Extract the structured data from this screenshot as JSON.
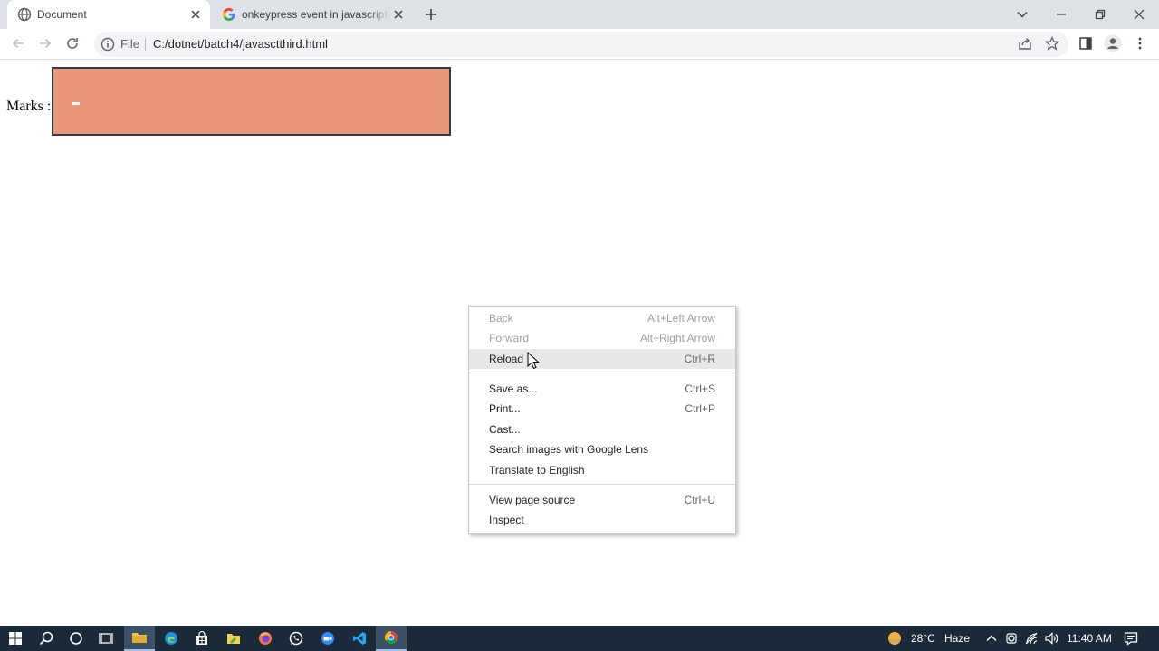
{
  "tabs": [
    {
      "title": "Document",
      "icon": "globe-icon",
      "active": true
    },
    {
      "title": "onkeypress event in javascript - Google Search",
      "icon": "google-icon",
      "active": false
    }
  ],
  "toolbar": {
    "omnibox_scheme": "File",
    "url": "C:/dotnet/batch4/javasctthird.html"
  },
  "page": {
    "marks_label": "Marks :",
    "marks_value": ""
  },
  "context_menu": {
    "items": [
      {
        "label": "Back",
        "shortcut": "Alt+Left Arrow",
        "disabled": true
      },
      {
        "label": "Forward",
        "shortcut": "Alt+Right Arrow",
        "disabled": true
      },
      {
        "label": "Reload",
        "shortcut": "Ctrl+R",
        "hovered": true
      },
      {
        "label": "Save as...",
        "shortcut": "Ctrl+S"
      },
      {
        "label": "Print...",
        "shortcut": "Ctrl+P"
      },
      {
        "label": "Cast...",
        "shortcut": ""
      },
      {
        "label": "Search images with Google Lens",
        "shortcut": ""
      },
      {
        "label": "Translate to English",
        "shortcut": ""
      },
      {
        "label": "View page source",
        "shortcut": "Ctrl+U"
      },
      {
        "label": "Inspect",
        "shortcut": ""
      }
    ]
  },
  "taskbar": {
    "weather_temp": "28°C",
    "weather_desc": "Haze",
    "time": "11:40 AM"
  },
  "colors": {
    "input_background": "#e9967a",
    "tabstrip": "#dee1e6",
    "taskbar": "#1b2a3a"
  }
}
